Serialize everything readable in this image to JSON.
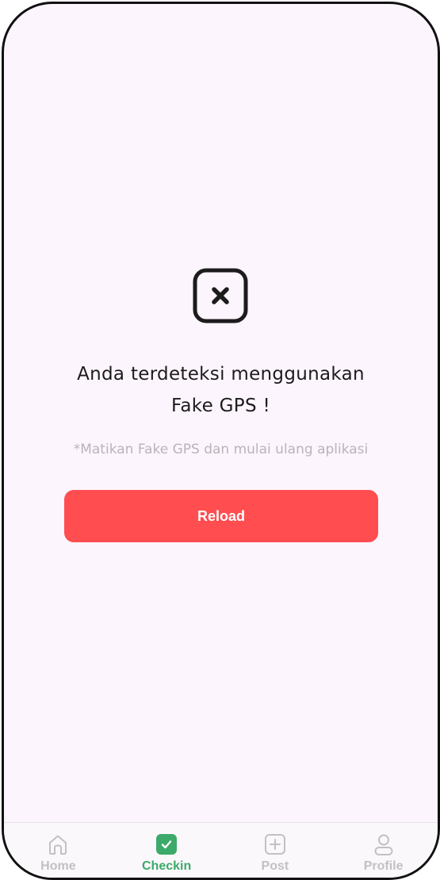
{
  "message": {
    "title_line1": "Anda terdeteksi menggunakan",
    "title_line2": "Fake GPS !",
    "hint": "*Matikan Fake GPS dan mulai ulang aplikasi",
    "icon": "close-square-icon"
  },
  "reload_button": {
    "label": "Reload",
    "color": "#ff4d50"
  },
  "bottom_nav": {
    "active_color": "#3caa6a",
    "inactive_color": "#c3c0c3",
    "active_tab": "Checkin",
    "items": [
      {
        "label": "Home",
        "icon": "home-icon"
      },
      {
        "label": "Checkin",
        "icon": "checkin-icon"
      },
      {
        "label": "Post",
        "icon": "add-post-icon"
      },
      {
        "label": "Profile",
        "icon": "profile-icon"
      }
    ]
  }
}
